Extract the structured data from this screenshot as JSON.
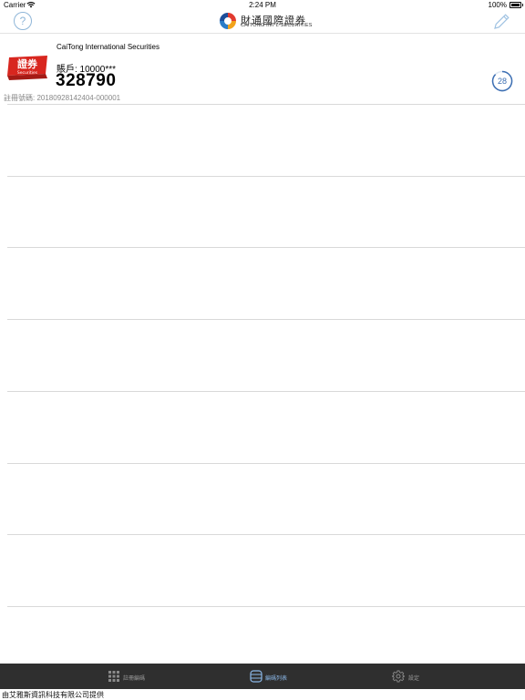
{
  "status_bar": {
    "carrier": "Carrier",
    "time": "2:24 PM",
    "battery": "100%"
  },
  "header": {
    "logo_name": "財通國際證券",
    "logo_subname": "CAITONG INT'L SECURITIES"
  },
  "account": {
    "company": "CaiTong International Securities",
    "account_line": "賬戶: 10000***",
    "otp_code": "328790",
    "registration": "註冊號碼: 20180928142404-000001",
    "timer_seconds": "28",
    "badge_text": "證券",
    "badge_subtext": "Securities"
  },
  "tabs": [
    {
      "label": "註冊編碼",
      "icon": "grid-icon"
    },
    {
      "label": "編碼列表",
      "icon": "list-box-icon",
      "active": true
    },
    {
      "label": "設定",
      "icon": "gear-icon"
    }
  ],
  "footer": {
    "text": "由艾雅斯資訊科技有限公司提供"
  },
  "colors": {
    "accent": "#3d6fb3",
    "tabbar": "#2f2f2f",
    "active_tab": "#8bb8e8",
    "badge_red": "#d8261f"
  }
}
